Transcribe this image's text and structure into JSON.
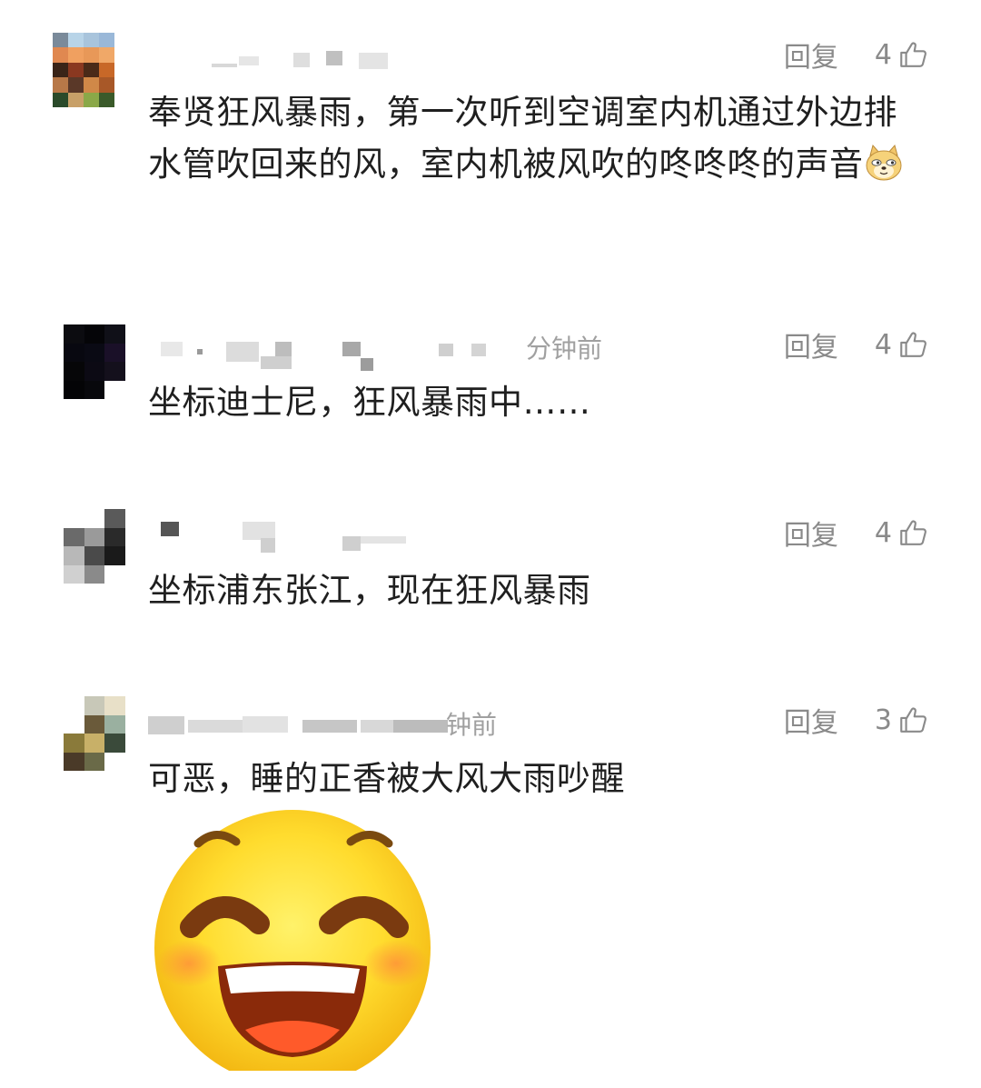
{
  "comments": [
    {
      "reply_label": "回复",
      "likes": "4",
      "time": "",
      "text": "奉贤狂风暴雨，第一次听到空调室内机通过外边排水管吹回来的风，室内机被风吹的咚咚咚的声音",
      "inline_emoji": "doge-icon"
    },
    {
      "reply_label": "回复",
      "likes": "4",
      "time": "分钟前",
      "text": "坐标迪士尼，狂风暴雨中……"
    },
    {
      "reply_label": "回复",
      "likes": "4",
      "time": "",
      "text": "坐标浦东张江，现在狂风暴雨"
    },
    {
      "reply_label": "回复",
      "likes": "3",
      "time": "钟前",
      "text": "可恶，睡的正香被大风大雨吵醒",
      "sticker": "laughing-face-sticker"
    }
  ],
  "colors": {
    "text": "#1f1f1f",
    "meta": "#8a8a8a",
    "time": "#a0a0a0"
  }
}
